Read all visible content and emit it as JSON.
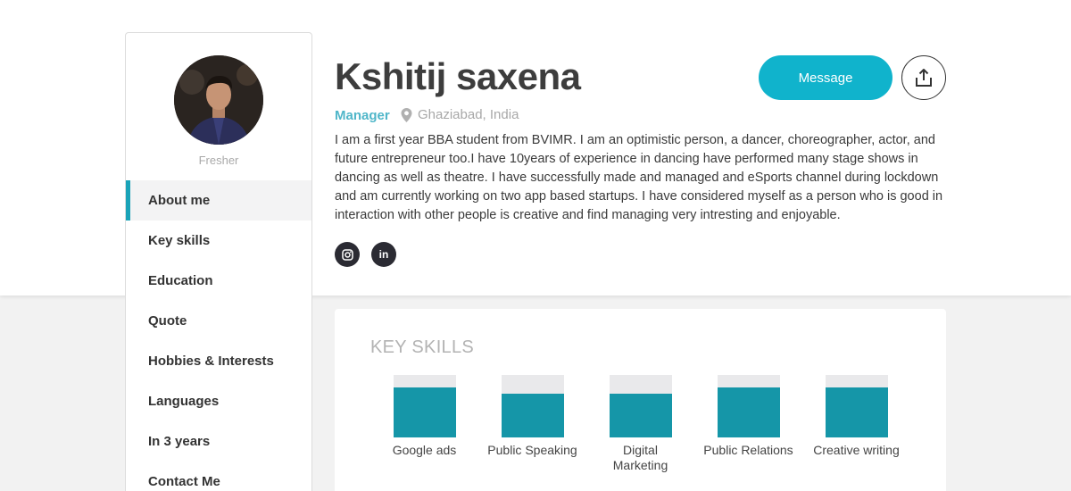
{
  "profile": {
    "name": "Kshitij saxena",
    "role": "Manager",
    "location": "Ghaziabad, India",
    "status": "Fresher",
    "bio": "I am a first year BBA student from BVIMR. I am an optimistic person, a dancer, choreographer, actor, and future entrepreneur too.I have 10years of experience in dancing have performed many stage shows in dancing as well as theatre. I have successfully made and managed and eSports channel during lockdown and am currently working on two app based startups. I have considered myself as a person who is good in interaction with other people is creative and find managing very intresting and enjoyable."
  },
  "actions": {
    "message_label": "Message",
    "share_icon": "share-icon"
  },
  "socials": [
    {
      "icon": "instagram-icon",
      "glyph": "◎"
    },
    {
      "icon": "linkedin-icon",
      "glyph": "in"
    }
  ],
  "nav": {
    "items": [
      {
        "label": "About me",
        "active": true
      },
      {
        "label": "Key skills"
      },
      {
        "label": "Education"
      },
      {
        "label": "Quote"
      },
      {
        "label": "Hobbies & Interests"
      },
      {
        "label": "Languages"
      },
      {
        "label": "In 3 years"
      },
      {
        "label": "Contact Me"
      }
    ]
  },
  "skills": {
    "title": "KEY SKILLS",
    "items": [
      {
        "label": "Google ads",
        "level": 0.8
      },
      {
        "label": "Public Speaking",
        "level": 0.7
      },
      {
        "label": "Digital Marketing",
        "level": 0.7
      },
      {
        "label": "Public Relations",
        "level": 0.8
      },
      {
        "label": "Creative writing",
        "level": 0.8
      }
    ]
  },
  "colors": {
    "accent": "#10b3cc",
    "skill_bar": "#1596a8",
    "role_text": "#4fb6c9"
  }
}
